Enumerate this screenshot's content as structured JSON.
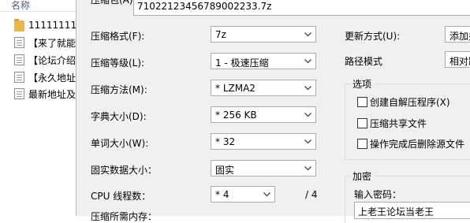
{
  "explorer": {
    "header": "名称",
    "files": [
      {
        "name": "11111111",
        "icon": "folder-icon"
      },
      {
        "name": "【来了就能",
        "icon": "document-icon"
      },
      {
        "name": "【论坛介绍",
        "icon": "document-icon"
      },
      {
        "name": "【永久地址",
        "icon": "document-icon"
      },
      {
        "name": "最新地址及",
        "icon": "document-icon"
      }
    ]
  },
  "dialog": {
    "archive_label": "压缩包(A):",
    "archive_name": "71022123456789002233.7z",
    "format": {
      "label": "压缩格式(F):",
      "value": "7z"
    },
    "level": {
      "label": "压缩等级(L):",
      "value": "1 - 极速压缩"
    },
    "method": {
      "label": "压缩方法(M):",
      "value": "* LZMA2"
    },
    "dict": {
      "label": "字典大小(D):",
      "value": "* 256 KB"
    },
    "word": {
      "label": "单词大小(W):",
      "value": "* 32"
    },
    "solid": {
      "label": "固实数据大小：",
      "value": "固实"
    },
    "threads": {
      "label": "CPU 线程数：",
      "value": "* 4",
      "max": "/ 4"
    },
    "memory": {
      "label": "压缩所需内存："
    },
    "update": {
      "label": "更新方式(U):",
      "value": "添加并"
    },
    "path": {
      "label": "路径模式",
      "value": "相对路"
    },
    "options": {
      "title": "选项",
      "sfx": "创建自解压程序(X)",
      "shared": "压缩共享文件",
      "delete": "操作完成后删除源文件"
    },
    "encryption": {
      "title": "加密",
      "password_label": "输入密码：",
      "password_value": "上老王论坛当老王"
    }
  }
}
